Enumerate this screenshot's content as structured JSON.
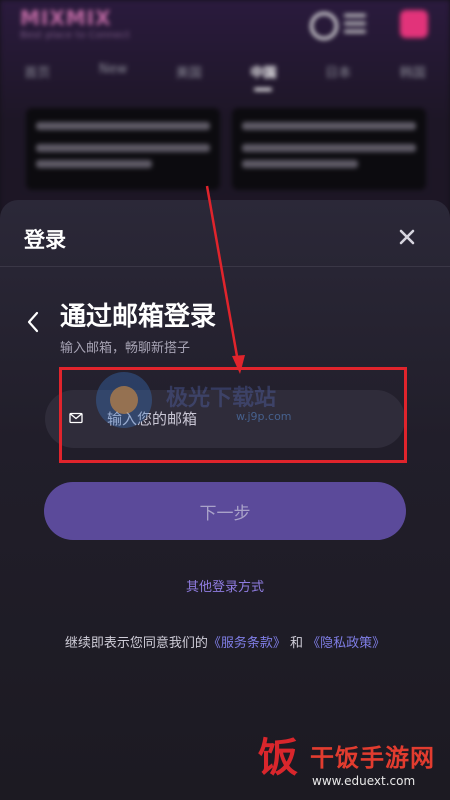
{
  "background_app": {
    "logo": "MIXMIX",
    "slogan": "Best place to Connect",
    "tabs": [
      {
        "label": "首页"
      },
      {
        "label": "New"
      },
      {
        "label": "美国"
      },
      {
        "label": "中国",
        "active": true
      },
      {
        "label": "日本"
      },
      {
        "label": "韩国"
      }
    ]
  },
  "modal": {
    "title": "登录",
    "heading": "通过邮箱登录",
    "subheading": "输入邮箱，畅聊新搭子",
    "email_placeholder": "输入您的邮箱",
    "email_value": "",
    "next_label": "下一步",
    "other_login": "其他登录方式",
    "terms": {
      "prefix": "继续即表示您同意我们的",
      "service": "《服务条款》",
      "and": " 和 ",
      "privacy": "《隐私政策》"
    }
  },
  "watermarks": {
    "center_text": "极光下载站",
    "center_url": "w.j9p.com",
    "brand_seal": "饭",
    "brand_name": "干饭手游网",
    "brand_url": "www.eduext.com"
  },
  "colors": {
    "accent": "#5b4a9a",
    "link": "#7f7ee6",
    "annotation": "#e0242c"
  }
}
